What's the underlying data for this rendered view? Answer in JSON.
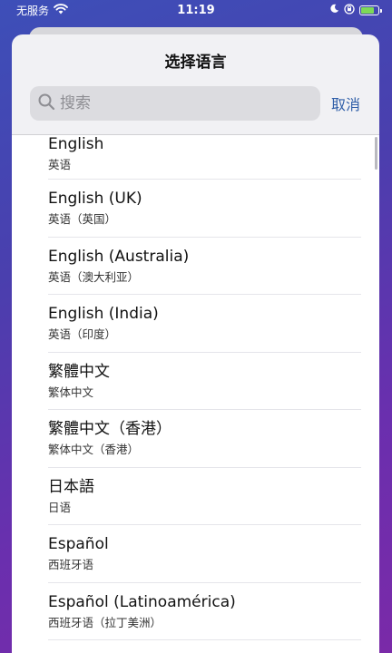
{
  "status_bar": {
    "carrier": "无服务",
    "time": "11:19"
  },
  "sheet": {
    "title": "选择语言",
    "search": {
      "placeholder": "搜索",
      "value": ""
    },
    "cancel_label": "取消"
  },
  "languages": [
    {
      "name": "English",
      "native": "英语"
    },
    {
      "name": "English (UK)",
      "native": "英语（英国）"
    },
    {
      "name": "English (Australia)",
      "native": "英语（澳大利亚）"
    },
    {
      "name": "English (India)",
      "native": "英语（印度）"
    },
    {
      "name": "繁體中文",
      "native": "繁体中文"
    },
    {
      "name": "繁體中文（香港）",
      "native": "繁体中文（香港）"
    },
    {
      "name": "日本語",
      "native": "日语"
    },
    {
      "name": "Español",
      "native": "西班牙语"
    },
    {
      "name": "Español (Latinoamérica)",
      "native": "西班牙语（拉丁美洲）"
    }
  ],
  "colors": {
    "accent": "#2f5ea8",
    "battery": "#7ed957"
  },
  "battery_level": 0.8
}
